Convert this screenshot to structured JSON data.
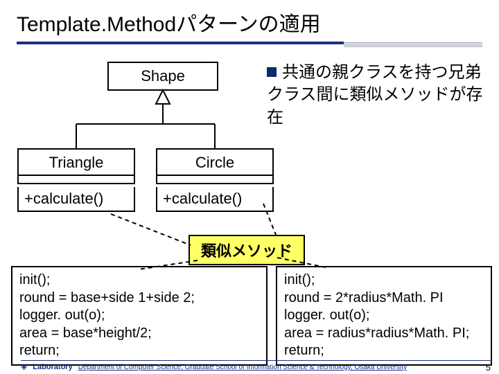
{
  "title": "Template.Methodパターンの適用",
  "bullet": "共通の親クラスを持つ兄弟クラス間に類似メソッドが存在",
  "uml": {
    "parent": "Shape",
    "left": {
      "name": "Triangle",
      "method": "+calculate()"
    },
    "right": {
      "name": "Circle",
      "method": "+calculate()"
    }
  },
  "label_similar": "類似メソッド",
  "code_left": "init();\nround = base+side 1+side 2;\nlogger. out(o);\narea = base*height/2;\nreturn;",
  "code_right": "init();\nround = 2*radius*Math. PI\nlogger. out(o);\narea = radius*radius*Math. PI;\nreturn;",
  "footer": {
    "lab": "Laboratory",
    "dept": "Department of Computer Science, Graduate School of Information Science & Technology, Osaka University"
  },
  "page_num": "5"
}
